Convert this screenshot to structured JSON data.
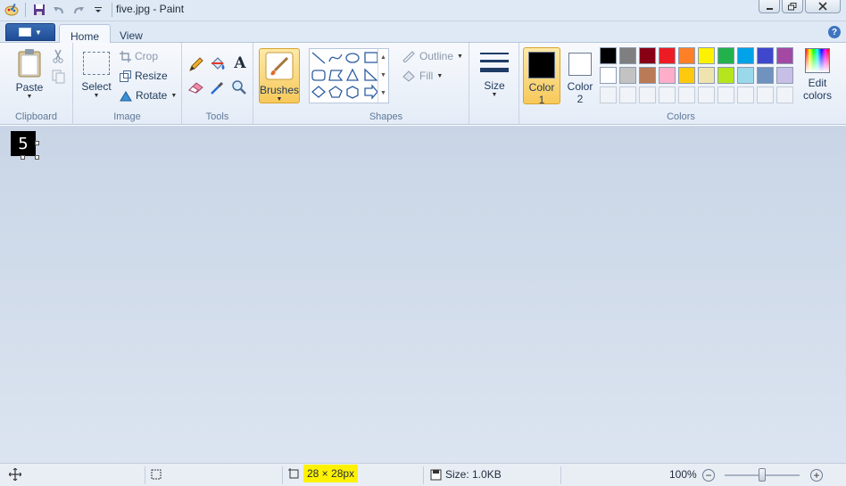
{
  "window": {
    "title": "five.jpg - Paint"
  },
  "tabs": [
    {
      "label": "Home"
    },
    {
      "label": "View"
    }
  ],
  "clipboard": {
    "paste_label": "Paste",
    "group_label": "Clipboard"
  },
  "image": {
    "select_label": "Select",
    "crop_label": "Crop",
    "resize_label": "Resize",
    "rotate_label": "Rotate",
    "group_label": "Image"
  },
  "tools": {
    "group_label": "Tools"
  },
  "brushes": {
    "label": "Brushes"
  },
  "shapes": {
    "outline_label": "Outline",
    "fill_label": "Fill",
    "group_label": "Shapes"
  },
  "size": {
    "label": "Size"
  },
  "colors": {
    "color1_label": "Color",
    "color1_num": "1",
    "color2_label": "Color",
    "color2_num": "2",
    "edit_label_1": "Edit",
    "edit_label_2": "colors",
    "group_label": "Colors",
    "color1_value": "#000000",
    "color2_value": "#ffffff",
    "palette_row1": [
      "#000000",
      "#7f7f7f",
      "#880015",
      "#ed1c24",
      "#ff7f27",
      "#fff200",
      "#22b14c",
      "#00a2e8",
      "#3f48cc",
      "#a349a4"
    ],
    "palette_row2": [
      "#ffffff",
      "#c3c3c3",
      "#b97a57",
      "#ffaec9",
      "#ffc90e",
      "#efe4b0",
      "#b5e61d",
      "#99d9ea",
      "#7092be",
      "#c8bfe7"
    ]
  },
  "canvas": {
    "glyph": "5"
  },
  "status": {
    "dimensions": "28 × 28px",
    "size": "Size: 1.0KB",
    "zoom": "100%"
  }
}
